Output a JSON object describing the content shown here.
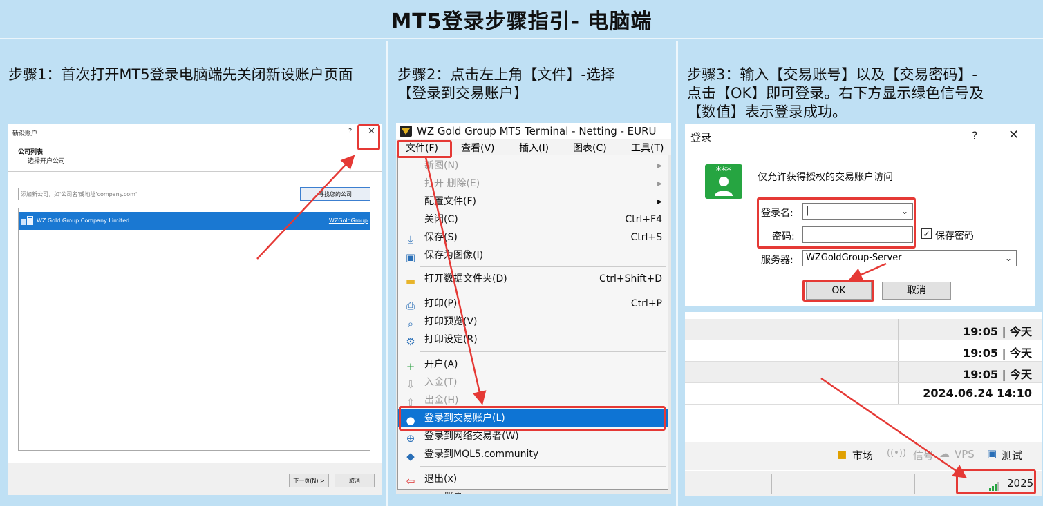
{
  "banner": {
    "title": "MT5登录步骤指引- 电脑端"
  },
  "step1": {
    "text": "步骤1：首次打开MT5登录电脑端先关闭新设账户页面",
    "dialog": {
      "title": "新设账户",
      "help": "?",
      "close": "✕",
      "heading": "公司列表",
      "subheading": "选择开户公司",
      "input_placeholder": "添加新公司，如'公司名'或地址'company.com'",
      "find_button": "寻找您的公司",
      "company_name": "WZ Gold Group Company Limited",
      "company_link": "WZGoldGroup",
      "next_button": "下一页(N) >",
      "cancel_button": "取消"
    }
  },
  "step2": {
    "text_line1": "步骤2：点击左上角【文件】-选择",
    "text_line2": "【登录到交易账户】",
    "window_title": "WZ Gold Group MT5 Terminal - Netting - EURU",
    "menubar": [
      "文件(F)",
      "查看(V)",
      "插入(I)",
      "图表(C)",
      "工具(T)"
    ],
    "menu": [
      {
        "label": "新图(N)",
        "shortcut": "▸",
        "icon": "",
        "disabled": true
      },
      {
        "label": "打开 删除(E)",
        "shortcut": "▸",
        "icon": "",
        "disabled": true
      },
      {
        "label": "配置文件(F)",
        "shortcut": "▸",
        "icon": "",
        "disabled": false
      },
      {
        "label": "关闭(C)",
        "shortcut": "Ctrl+F4",
        "icon": "",
        "disabled": false
      },
      {
        "label": "保存(S)",
        "shortcut": "Ctrl+S",
        "icon": "⤓",
        "disabled": false
      },
      {
        "label": "保存为图像(I)",
        "shortcut": "",
        "icon": "▣",
        "disabled": false
      },
      {
        "label": "打开数据文件夹(D)",
        "shortcut": "Ctrl+Shift+D",
        "icon": "▬",
        "disabled": false
      },
      {
        "label": "打印(P)",
        "shortcut": "Ctrl+P",
        "icon": "⎙",
        "disabled": false
      },
      {
        "label": "打印预览(V)",
        "shortcut": "",
        "icon": "⌕",
        "disabled": false
      },
      {
        "label": "打印设定(R)",
        "shortcut": "",
        "icon": "⚙",
        "disabled": false
      },
      {
        "label": "开户(A)",
        "shortcut": "",
        "icon": "+",
        "disabled": false
      },
      {
        "label": "入金(T)",
        "shortcut": "",
        "icon": "⇩",
        "disabled": true
      },
      {
        "label": "出金(H)",
        "shortcut": "",
        "icon": "⇧",
        "disabled": true
      },
      {
        "label": "登录到交易账户(L)",
        "shortcut": "",
        "icon": "●",
        "disabled": false,
        "selected": true
      },
      {
        "label": "登录到网络交易者(W)",
        "shortcut": "",
        "icon": "⊕",
        "disabled": false
      },
      {
        "label": "登录到MQL5.community",
        "shortcut": "",
        "icon": "◆",
        "disabled": false
      },
      {
        "label": "退出(x)",
        "shortcut": "",
        "icon": "⇦",
        "disabled": false
      }
    ],
    "peek_label": "账户"
  },
  "step3": {
    "text_line1": "步骤3：输入【交易账号】以及【交易密码】-",
    "text_line2": "点击【OK】即可登录。右下方显示绿色信号及",
    "text_line3": "【数值】表示登录成功。",
    "dialog": {
      "title": "登录",
      "help": "?",
      "close": "✕",
      "logo_stars": "***",
      "message": "仅允许获得授权的交易账户访问",
      "login_label": "登录名:",
      "login_value": "|",
      "password_label": "密码:",
      "save_password": "保存密码",
      "server_label": "服务器:",
      "server_value": "WZGoldGroup-Server",
      "ok_button": "OK",
      "cancel_button": "取消"
    },
    "times": [
      "19:05 | 今天",
      "19:05 | 今天",
      "19:05 | 今天",
      "2024.06.24 14:10"
    ],
    "statusbar": [
      "市场",
      "信号",
      "VPS",
      "测试"
    ],
    "signal_value": "2025",
    "colors": {
      "red": "#e53935",
      "selected_blue": "#0e74d4",
      "signal_green": "#26a541"
    }
  }
}
